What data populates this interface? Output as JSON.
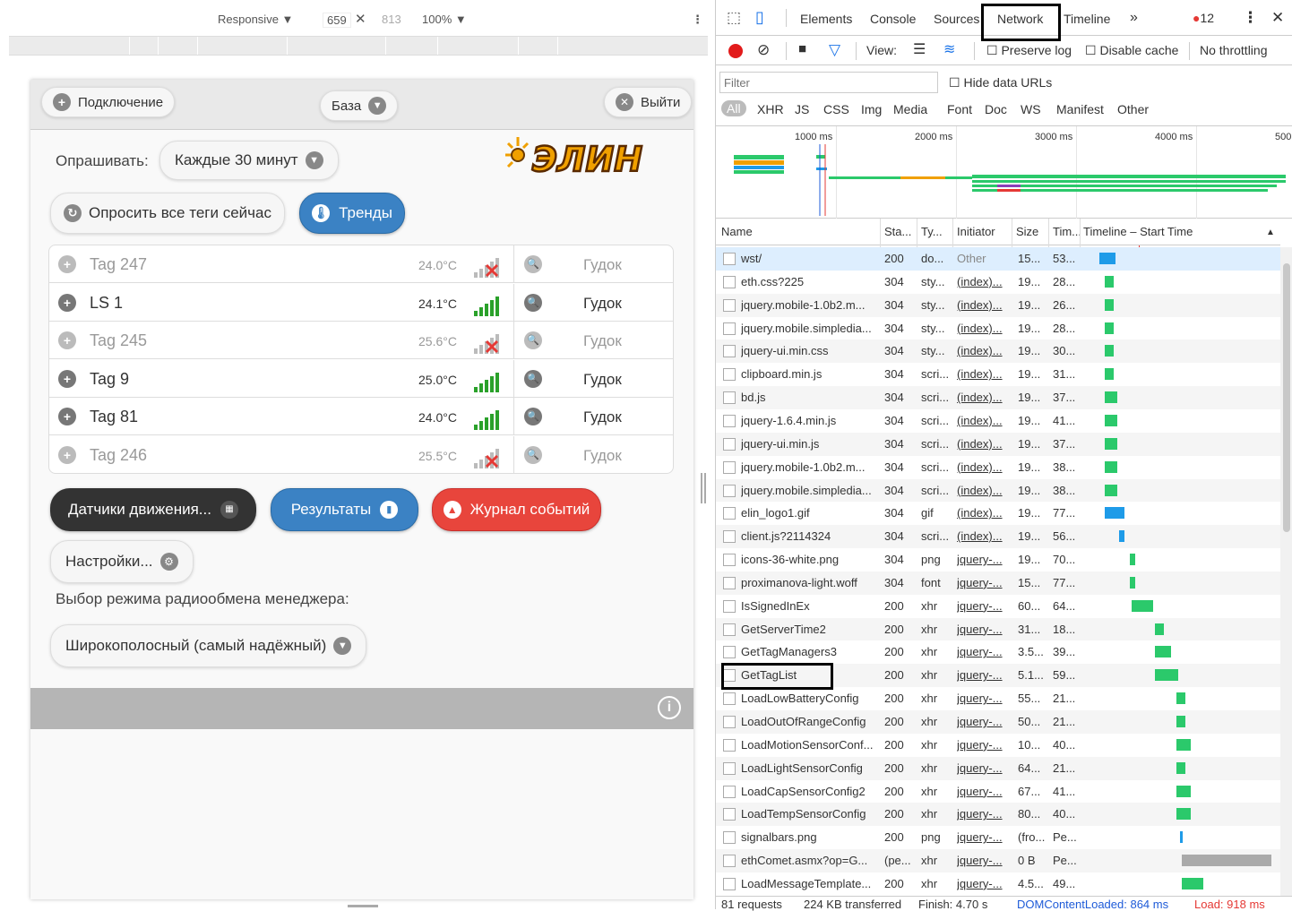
{
  "device_bar": {
    "mode": "Responsive",
    "width": "659",
    "x": "✕",
    "height": "813",
    "zoom": "100%"
  },
  "app": {
    "header": {
      "connect": "Подключение",
      "base": "База",
      "logout": "Выйти"
    },
    "poll_label": "Опрашивать:",
    "poll_value": "Каждые 30 минут",
    "poll_all": "Опросить все теги сейчас",
    "trends": "Тренды",
    "logo_text": "ЭЛИН",
    "tags": [
      {
        "name": "Tag 247",
        "temp": "24.0°C",
        "beep": "Гудок",
        "online": false
      },
      {
        "name": "LS 1",
        "temp": "24.1°C",
        "beep": "Гудок",
        "online": true
      },
      {
        "name": "Tag 245",
        "temp": "25.6°C",
        "beep": "Гудок",
        "online": false
      },
      {
        "name": "Tag 9",
        "temp": "25.0°C",
        "beep": "Гудок",
        "online": true
      },
      {
        "name": "Tag 81",
        "temp": "24.0°C",
        "beep": "Гудок",
        "online": true
      },
      {
        "name": "Tag 246",
        "temp": "25.5°C",
        "beep": "Гудок",
        "online": false
      }
    ],
    "motion": "Датчики движения...",
    "results": "Результаты",
    "events": "Журнал событий",
    "settings": "Настройки...",
    "radio_label": "Выбор режима радиообмена менеджера:",
    "radio_value": "Широкополосный (самый надёжный)"
  },
  "devtools": {
    "tabs": [
      "Elements",
      "Console",
      "Sources",
      "Network",
      "Timeline"
    ],
    "errors": "12",
    "view": "View:",
    "preserve": "Preserve log",
    "disable_cache": "Disable cache",
    "throttling": "No throttling",
    "filter_placeholder": "Filter",
    "hide_data": "Hide data URLs",
    "types": [
      "All",
      "XHR",
      "JS",
      "CSS",
      "Img",
      "Media",
      "Font",
      "Doc",
      "WS",
      "Manifest",
      "Other"
    ],
    "ticks": [
      "1000 ms",
      "2000 ms",
      "3000 ms",
      "4000 ms",
      "500"
    ],
    "columns": {
      "name": "Name",
      "status": "Sta...",
      "type": "Ty...",
      "initiator": "Initiator",
      "size": "Size",
      "time": "Tim...",
      "timeline": "Timeline – Start Time"
    },
    "requests": [
      {
        "name": "wst/",
        "status": "200",
        "type": "do...",
        "init": "Other",
        "size": "15...",
        "time": "53...",
        "s": 0,
        "w": 18,
        "c": "#1e9be8"
      },
      {
        "name": "eth.css?225",
        "status": "304",
        "type": "sty...",
        "init": "(index)...",
        "size": "19...",
        "time": "28...",
        "s": 6,
        "w": 10,
        "c": "#2bc96b"
      },
      {
        "name": "jquery.mobile-1.0b2.m...",
        "status": "304",
        "type": "sty...",
        "init": "(index)...",
        "size": "19...",
        "time": "26...",
        "s": 6,
        "w": 10,
        "c": "#2bc96b"
      },
      {
        "name": "jquery.mobile.simpledia...",
        "status": "304",
        "type": "sty...",
        "init": "(index)...",
        "size": "19...",
        "time": "28...",
        "s": 6,
        "w": 10,
        "c": "#2bc96b"
      },
      {
        "name": "jquery-ui.min.css",
        "status": "304",
        "type": "sty...",
        "init": "(index)...",
        "size": "19...",
        "time": "30...",
        "s": 6,
        "w": 10,
        "c": "#2bc96b"
      },
      {
        "name": "clipboard.min.js",
        "status": "304",
        "type": "scri...",
        "init": "(index)...",
        "size": "19...",
        "time": "31...",
        "s": 6,
        "w": 10,
        "c": "#2bc96b"
      },
      {
        "name": "bd.js",
        "status": "304",
        "type": "scri...",
        "init": "(index)...",
        "size": "19...",
        "time": "37...",
        "s": 6,
        "w": 14,
        "c": "#2bc96b"
      },
      {
        "name": "jquery-1.6.4.min.js",
        "status": "304",
        "type": "scri...",
        "init": "(index)...",
        "size": "19...",
        "time": "41...",
        "s": 6,
        "w": 14,
        "c": "#2bc96b"
      },
      {
        "name": "jquery-ui.min.js",
        "status": "304",
        "type": "scri...",
        "init": "(index)...",
        "size": "19...",
        "time": "37...",
        "s": 6,
        "w": 14,
        "c": "#2bc96b"
      },
      {
        "name": "jquery.mobile-1.0b2.m...",
        "status": "304",
        "type": "scri...",
        "init": "(index)...",
        "size": "19...",
        "time": "38...",
        "s": 6,
        "w": 14,
        "c": "#2bc96b"
      },
      {
        "name": "jquery.mobile.simpledia...",
        "status": "304",
        "type": "scri...",
        "init": "(index)...",
        "size": "19...",
        "time": "38...",
        "s": 6,
        "w": 14,
        "c": "#2bc96b"
      },
      {
        "name": "elin_logo1.gif",
        "status": "304",
        "type": "gif",
        "init": "(index)...",
        "size": "19...",
        "time": "77...",
        "s": 6,
        "w": 22,
        "c": "#1e9be8"
      },
      {
        "name": "client.js?2114324",
        "status": "304",
        "type": "scri...",
        "init": "(index)...",
        "size": "19...",
        "time": "56...",
        "s": 22,
        "w": 6,
        "c": "#1e9be8"
      },
      {
        "name": "icons-36-white.png",
        "status": "304",
        "type": "png",
        "init": "jquery-...",
        "size": "19...",
        "time": "70...",
        "s": 34,
        "w": 6,
        "c": "#2bc96b"
      },
      {
        "name": "proximanova-light.woff",
        "status": "304",
        "type": "font",
        "init": "jquery-...",
        "size": "15...",
        "time": "77...",
        "s": 34,
        "w": 6,
        "c": "#2bc96b"
      },
      {
        "name": "IsSignedInEx",
        "status": "200",
        "type": "xhr",
        "init": "jquery-...",
        "size": "60...",
        "time": "64...",
        "s": 36,
        "w": 24,
        "c": "#2bc96b"
      },
      {
        "name": "GetServerTime2",
        "status": "200",
        "type": "xhr",
        "init": "jquery-...",
        "size": "31...",
        "time": "18...",
        "s": 62,
        "w": 10,
        "c": "#2bc96b"
      },
      {
        "name": "GetTagManagers3",
        "status": "200",
        "type": "xhr",
        "init": "jquery-...",
        "size": "3.5...",
        "time": "39...",
        "s": 62,
        "w": 18,
        "c": "#2bc96b"
      },
      {
        "name": "GetTagList",
        "status": "200",
        "type": "xhr",
        "init": "jquery-...",
        "size": "5.1...",
        "time": "59...",
        "s": 62,
        "w": 26,
        "c": "#2bc96b"
      },
      {
        "name": "LoadLowBatteryConfig",
        "status": "200",
        "type": "xhr",
        "init": "jquery-...",
        "size": "55...",
        "time": "21...",
        "s": 86,
        "w": 10,
        "c": "#2bc96b"
      },
      {
        "name": "LoadOutOfRangeConfig",
        "status": "200",
        "type": "xhr",
        "init": "jquery-...",
        "size": "50...",
        "time": "21...",
        "s": 86,
        "w": 10,
        "c": "#2bc96b"
      },
      {
        "name": "LoadMotionSensorConf...",
        "status": "200",
        "type": "xhr",
        "init": "jquery-...",
        "size": "10...",
        "time": "40...",
        "s": 86,
        "w": 16,
        "c": "#2bc96b"
      },
      {
        "name": "LoadLightSensorConfig",
        "status": "200",
        "type": "xhr",
        "init": "jquery-...",
        "size": "64...",
        "time": "21...",
        "s": 86,
        "w": 10,
        "c": "#2bc96b"
      },
      {
        "name": "LoadCapSensorConfig2",
        "status": "200",
        "type": "xhr",
        "init": "jquery-...",
        "size": "67...",
        "time": "41...",
        "s": 86,
        "w": 16,
        "c": "#2bc96b"
      },
      {
        "name": "LoadTempSensorConfig",
        "status": "200",
        "type": "xhr",
        "init": "jquery-...",
        "size": "80...",
        "time": "40...",
        "s": 86,
        "w": 16,
        "c": "#2bc96b"
      },
      {
        "name": "signalbars.png",
        "status": "200",
        "type": "png",
        "init": "jquery-...",
        "size": "(fro...",
        "time": "Pe...",
        "s": 90,
        "w": 3,
        "c": "#1e9be8"
      },
      {
        "name": "ethComet.asmx?op=G...",
        "status": "(pe...",
        "type": "xhr",
        "init": "jquery-...",
        "size": "0 B",
        "time": "Pe...",
        "s": 92,
        "w": 100,
        "c": "#aaaaaa"
      },
      {
        "name": "LoadMessageTemplate...",
        "status": "200",
        "type": "xhr",
        "init": "jquery-...",
        "size": "4.5...",
        "time": "49...",
        "s": 92,
        "w": 24,
        "c": "#2bc96b"
      }
    ],
    "status_bar": {
      "requests": "81 requests",
      "transferred": "224 KB transferred",
      "finish": "Finish: 4.70 s",
      "dcl": "DOMContentLoaded: 864 ms",
      "load": "Load: 918 ms"
    }
  }
}
